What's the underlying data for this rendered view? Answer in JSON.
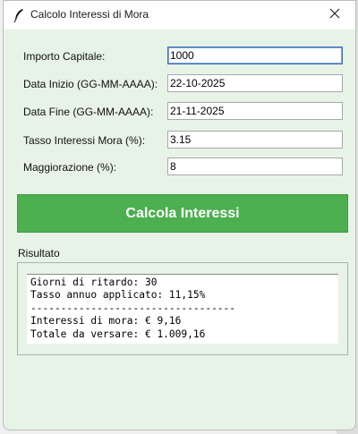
{
  "window": {
    "title": "Calcolo Interessi di Mora",
    "app_icon": "feather-icon",
    "close_icon": "close-icon"
  },
  "form": {
    "fields": [
      {
        "label": "Importo Capitale:",
        "value": "1000"
      },
      {
        "label": "Data Inizio (GG-MM-AAAA):",
        "value": "22-10-2025"
      },
      {
        "label": "Data Fine (GG-MM-AAAA):",
        "value": "21-11-2025"
      },
      {
        "label": "Tasso Interessi Mora (%):",
        "value": "3.15"
      },
      {
        "label": "Maggiorazione (%):",
        "value": "8"
      }
    ]
  },
  "calc_button": {
    "label": "Calcola Interessi",
    "color": "#4caf50"
  },
  "result": {
    "heading": "Risultato",
    "lines": [
      "Giorni di ritardo: 30",
      "Tasso annuo applicato: 11,15%",
      "----------------------------------",
      "Interessi di mora: € 9,16",
      "Totale da versare: € 1.009,16"
    ]
  }
}
